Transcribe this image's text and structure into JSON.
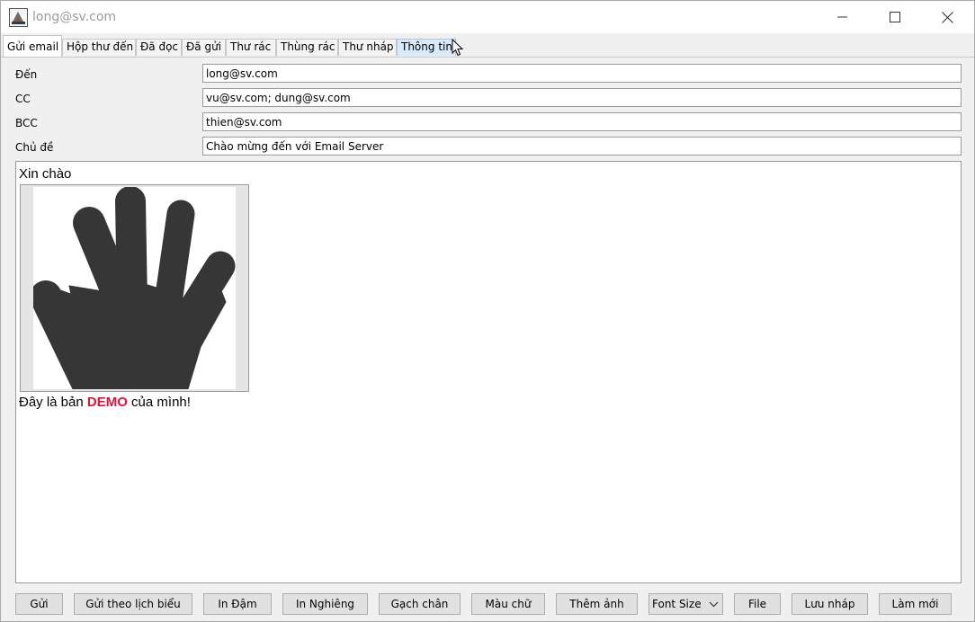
{
  "window": {
    "title": "long@sv.com"
  },
  "tabs": [
    {
      "label": "Gửi email",
      "active": true
    },
    {
      "label": "Hộp thư đến"
    },
    {
      "label": "Đã đọc"
    },
    {
      "label": "Đã gửi"
    },
    {
      "label": "Thư rác"
    },
    {
      "label": "Thùng rác"
    },
    {
      "label": "Thư nháp"
    },
    {
      "label": "Thông tin",
      "hovered": true
    }
  ],
  "form": {
    "to": {
      "label": "Đến",
      "value": "long@sv.com"
    },
    "cc": {
      "label": "CC",
      "value": "vu@sv.com; dung@sv.com"
    },
    "bcc": {
      "label": "BCC",
      "value": "thien@sv.com"
    },
    "subject": {
      "label": "Chủ đề",
      "value": "Chào mừng đến với Email Server"
    }
  },
  "editor": {
    "greeting": "Xin chào",
    "image_icon": "waving-hand-image",
    "body_prefix": "Đây là bản ",
    "body_highlight": "DEMO",
    "body_suffix": " của mình!",
    "highlight_color": "#e0143c"
  },
  "toolbar": {
    "send": "Gửi",
    "schedule": "Gửi theo lịch biểu",
    "bold": "In Đậm",
    "italic": "In Nghiêng",
    "underline": "Gạch chân",
    "color": "Màu chữ",
    "add_image": "Thêm ảnh",
    "font_size": "Font Size",
    "file": "File",
    "save_draft": "Lưu nháp",
    "reset": "Làm mới"
  }
}
